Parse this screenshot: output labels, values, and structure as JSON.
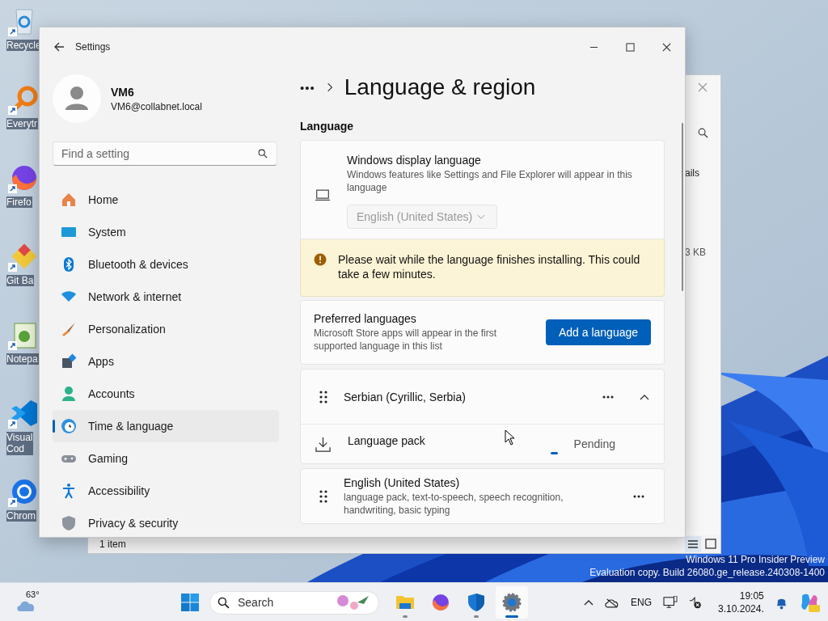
{
  "desktop": {
    "icons": [
      {
        "kind": "recycle",
        "lines": [
          "Recycle"
        ]
      },
      {
        "kind": "magnifier",
        "lines": [
          "Everytr"
        ]
      },
      {
        "kind": "firefox",
        "lines": [
          "Firefo"
        ]
      },
      {
        "kind": "git",
        "lines": [
          "Git Ba"
        ]
      },
      {
        "kind": "notepad",
        "lines": [
          "Notepa"
        ]
      },
      {
        "kind": "vscode",
        "lines": [
          "Visual",
          "Cod"
        ]
      },
      {
        "kind": "chrome",
        "lines": [
          "Chrom"
        ]
      }
    ],
    "watermark": [
      "Windows 11 Pro Insider Preview",
      "Evaluation copy. Build 26080.ge_release.240308-1400"
    ]
  },
  "explorer": {
    "column_text": "ails",
    "size_text": "3 KB",
    "status": "1 item"
  },
  "settings": {
    "title": "Settings",
    "user": {
      "name": "VM6",
      "email": "VM6@collabnet.local"
    },
    "search": {
      "placeholder": "Find a setting"
    },
    "nav": [
      {
        "kind": "home",
        "label": "Home",
        "selected": false
      },
      {
        "kind": "system",
        "label": "System",
        "selected": false
      },
      {
        "kind": "bluetooth",
        "label": "Bluetooth & devices",
        "selected": false
      },
      {
        "kind": "network",
        "label": "Network & internet",
        "selected": false
      },
      {
        "kind": "brush",
        "label": "Personalization",
        "selected": false
      },
      {
        "kind": "apps",
        "label": "Apps",
        "selected": false
      },
      {
        "kind": "accounts",
        "label": "Accounts",
        "selected": false
      },
      {
        "kind": "time",
        "label": "Time & language",
        "selected": true
      },
      {
        "kind": "gaming",
        "label": "Gaming",
        "selected": false
      },
      {
        "kind": "accessibility",
        "label": "Accessibility",
        "selected": false
      },
      {
        "kind": "privacy",
        "label": "Privacy & security",
        "selected": false
      }
    ],
    "breadcrumb": "•••",
    "page_title": "Language & region",
    "section": "Language",
    "display_language": {
      "title": "Windows display language",
      "description": "Windows features like Settings and File Explorer will appear in this language",
      "value": "English (United States)",
      "disabled": true
    },
    "warning": "Please wait while the language finishes installing. This could take a few minutes.",
    "preferred": {
      "title": "Preferred languages",
      "description": "Microsoft Store apps will appear in the first supported language in this list",
      "button": "Add a language"
    },
    "languages": [
      {
        "name": "Serbian (Cyrillic, Serbia)",
        "expanded": true,
        "feature": "Language pack",
        "status": "Pending"
      },
      {
        "name": "English (United States)",
        "description": "language pack, text-to-speech, speech recognition, handwriting, basic typing"
      }
    ]
  },
  "taskbar": {
    "temperature": "63°",
    "search": "Search",
    "apps": [
      {
        "kind": "folder",
        "running": true,
        "active": false
      },
      {
        "kind": "firefox",
        "running": false,
        "active": false
      },
      {
        "kind": "shield",
        "running": true,
        "active": false
      },
      {
        "kind": "gear",
        "running": true,
        "active": true
      }
    ],
    "language": "ENG",
    "time": "19:05",
    "date": "3.10.2024."
  }
}
